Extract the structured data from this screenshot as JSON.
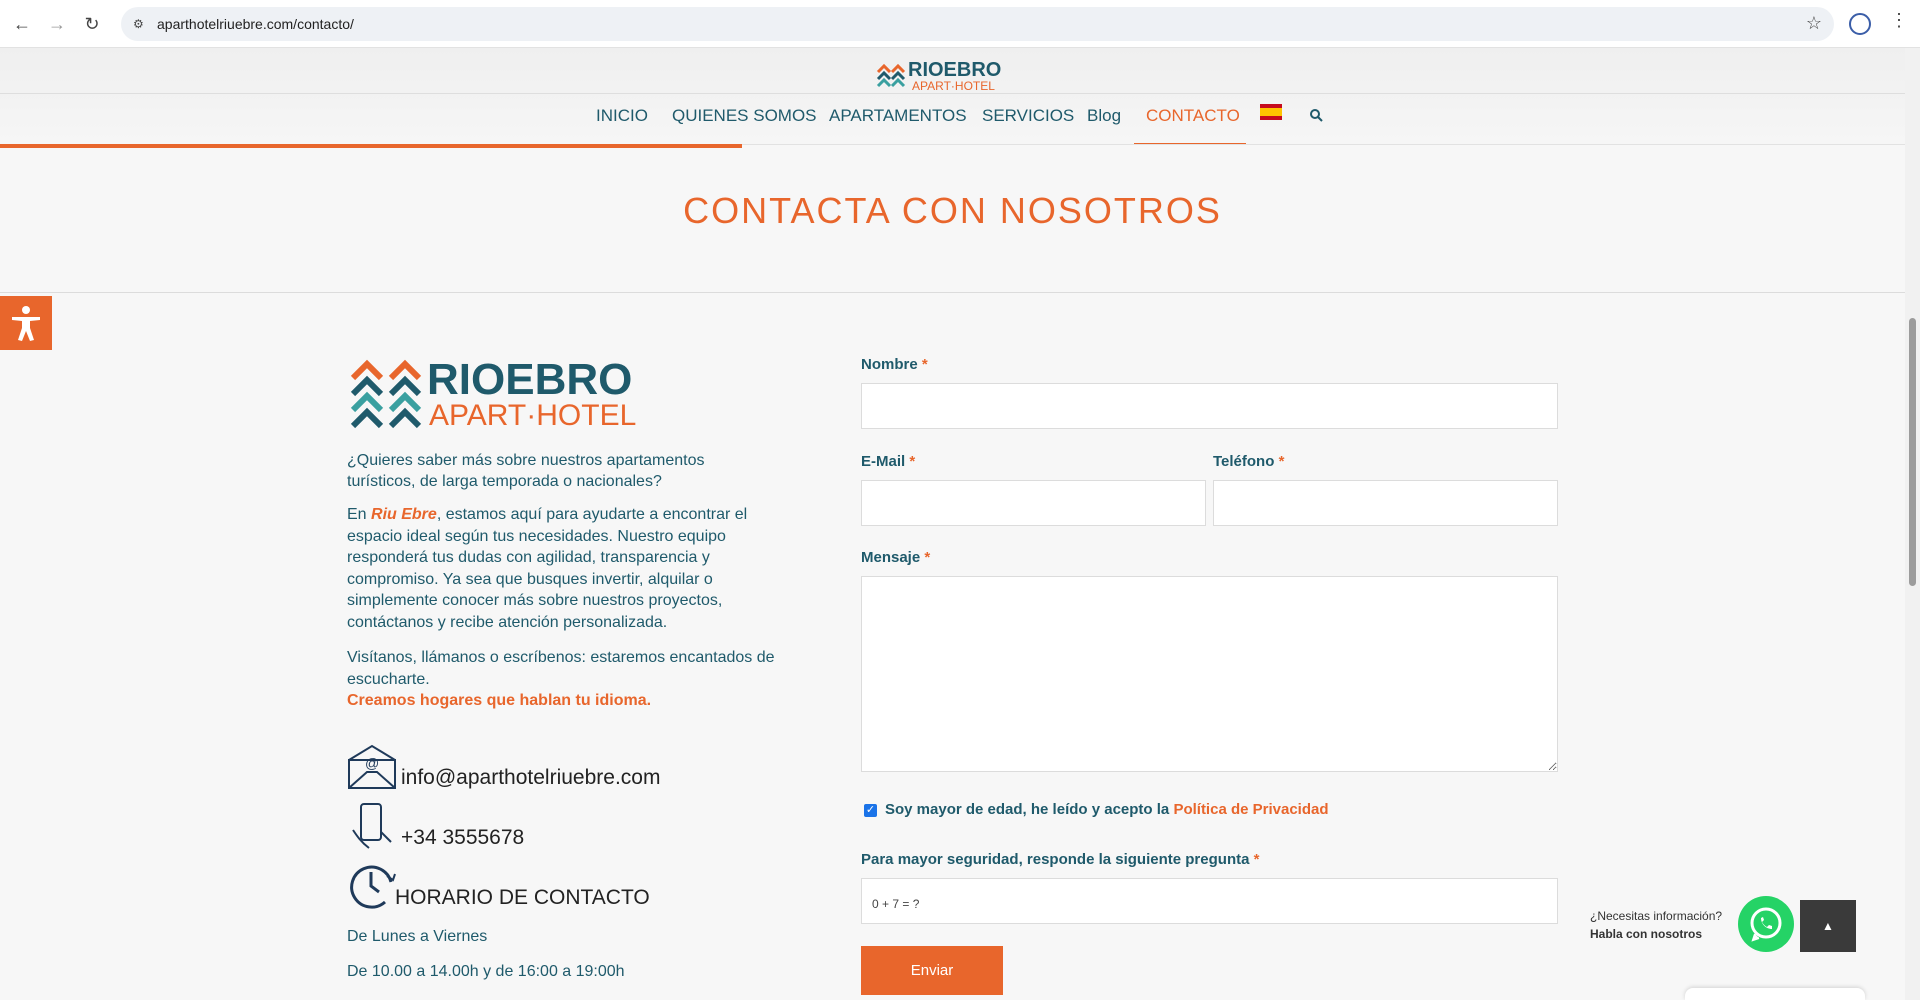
{
  "browser": {
    "url": "aparthotelriuebre.com/contacto/",
    "icons": [
      "back-arrow-icon",
      "forward-arrow-icon",
      "reload-icon",
      "site-info-icon",
      "bookmark-star-icon",
      "profile-icon",
      "more-menu-icon"
    ]
  },
  "header": {
    "logo_text_1": "RIOEBRO",
    "logo_text_2": "APART·HOTEL",
    "nav": {
      "inicio": "INICIO",
      "quienes": "QUIENES SOMOS",
      "apartamentos": "APARTAMENTOS",
      "servicios": "SERVICIOS",
      "blog": "Blog",
      "contacto": "CONTACTO"
    },
    "active_item": "CONTACTO",
    "accent_color": "#e8662c",
    "text_color": "#1f5a6b"
  },
  "page": {
    "title": "CONTACTA CON NOSOTROS"
  },
  "info": {
    "logo_text_1": "RIOEBRO",
    "logo_text_2": "APART·HOTEL",
    "intro": "¿Quieres saber más sobre nuestros apartamentos turísticos, de larga temporada o nacionales?",
    "p2_start": "En ",
    "brand": "Riu Ebre",
    "p2_rest": ", estamos aquí para ayudarte a encontrar el espacio ideal según tus necesidades. Nuestro equipo responderá tus dudas con agilidad, transparencia y compromiso. Ya sea que busques invertir, alquilar o simplemente conocer más sobre nuestros proyectos, contáctanos y recibe atención personalizada.",
    "p3": "Visítanos, llámanos o escríbenos: estaremos encantados de escucharte.",
    "slogan": "Creamos hogares que hablan tu idioma.",
    "email": "info@aparthotelriuebre.com",
    "phone": "+34 3555678",
    "hours_title": "HORARIO DE CONTACTO",
    "hours_days": "De Lunes a Viernes",
    "hours_times": "De 10.00 a 14.00h y de 16:00 a 19:00h"
  },
  "form": {
    "nombre_label": "Nombre",
    "email_label": "E-Mail",
    "telefono_label": "Teléfono",
    "mensaje_label": "Mensaje",
    "required_mark": "*",
    "nombre_value": "",
    "email_value": "",
    "telefono_value": "",
    "mensaje_value": "",
    "consent_text": "Soy mayor de edad, he leído y acepto la ",
    "consent_link": "Política de Privacidad",
    "consent_checked": true,
    "security_label": "Para mayor seguridad, responde la siguiente pregunta",
    "captcha_question": "0 + 7 = ?",
    "submit_label": "Enviar"
  },
  "widgets": {
    "whatsapp_line1": "¿Necesitas información?",
    "whatsapp_line2": "Habla con nosotros",
    "whatsapp_color": "#25d366"
  }
}
